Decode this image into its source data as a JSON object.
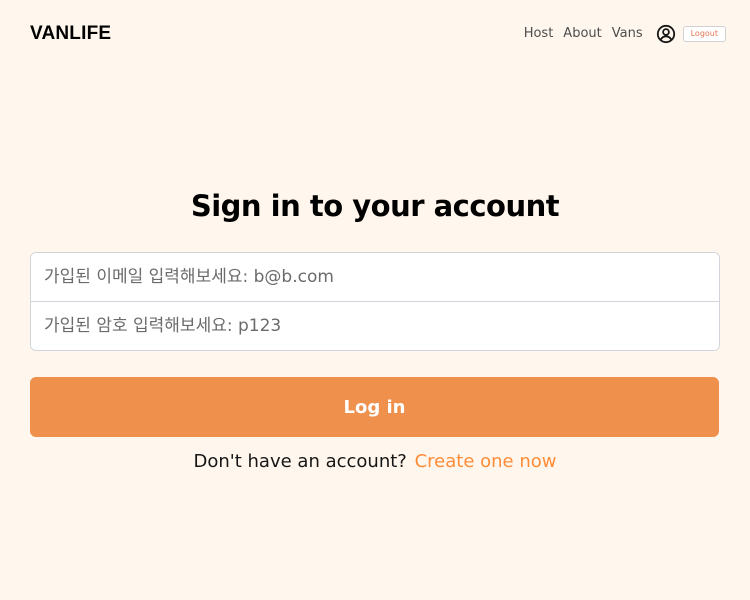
{
  "header": {
    "logo": "VANLIFE",
    "nav": {
      "host": "Host",
      "about": "About",
      "vans": "Vans",
      "profile_icon": "user-circle-icon",
      "logout": "Logout"
    }
  },
  "main": {
    "title": "Sign in to your account",
    "email_placeholder": "가입된 이메일 입력해보세요: b@b.com",
    "password_placeholder": "가입된 암호 입력해보세요: p123",
    "email_value": "",
    "password_value": "",
    "login_button": "Log in",
    "signup_prompt": "Don't have an account?",
    "signup_link": "Create one now"
  },
  "colors": {
    "background": "#FFF7ED",
    "accent": "#EF914D",
    "link": "#FF8C38",
    "logout_text": "#E17654"
  }
}
